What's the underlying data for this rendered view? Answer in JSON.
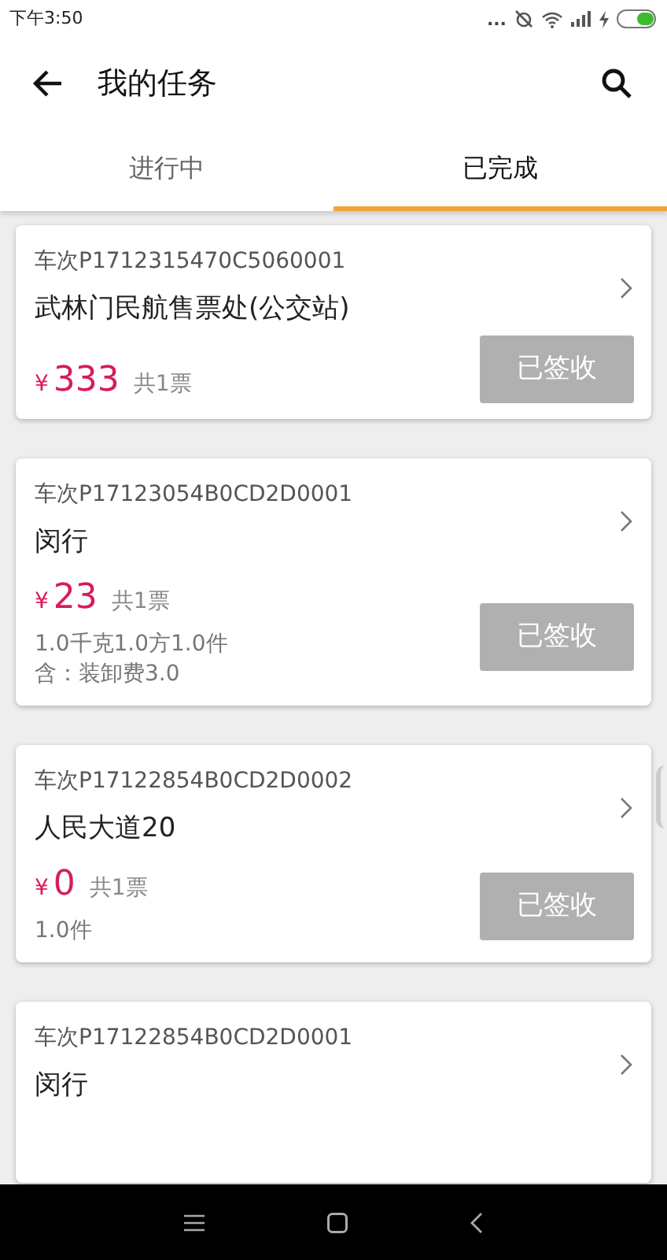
{
  "status_bar": {
    "time": "下午3:50",
    "more": "..."
  },
  "app_bar": {
    "title": "我的任务"
  },
  "tabs": [
    {
      "label": "进行中",
      "selected": false
    },
    {
      "label": "已完成",
      "selected": true
    }
  ],
  "tasks": [
    {
      "trip": "车次P1712315470C5060001",
      "name": "武林门民航售票处(公交站)",
      "currency": "¥",
      "amount": "333",
      "count": "共1票",
      "button": "已签收"
    },
    {
      "trip": "车次P17123054B0CD2D0001",
      "name": "闵行",
      "currency": "¥",
      "amount": "23",
      "count": "共1票",
      "details": [
        "1.0千克1.0方1.0件",
        "含：装卸费3.0"
      ],
      "button": "已签收"
    },
    {
      "trip": "车次P17122854B0CD2D0002",
      "name": "人民大道20",
      "currency": "¥",
      "amount": "0",
      "count": "共1票",
      "details": [
        "1.0件"
      ],
      "button": "已签收"
    },
    {
      "trip": "车次P17122854B0CD2D0001",
      "name": "闵行"
    }
  ]
}
